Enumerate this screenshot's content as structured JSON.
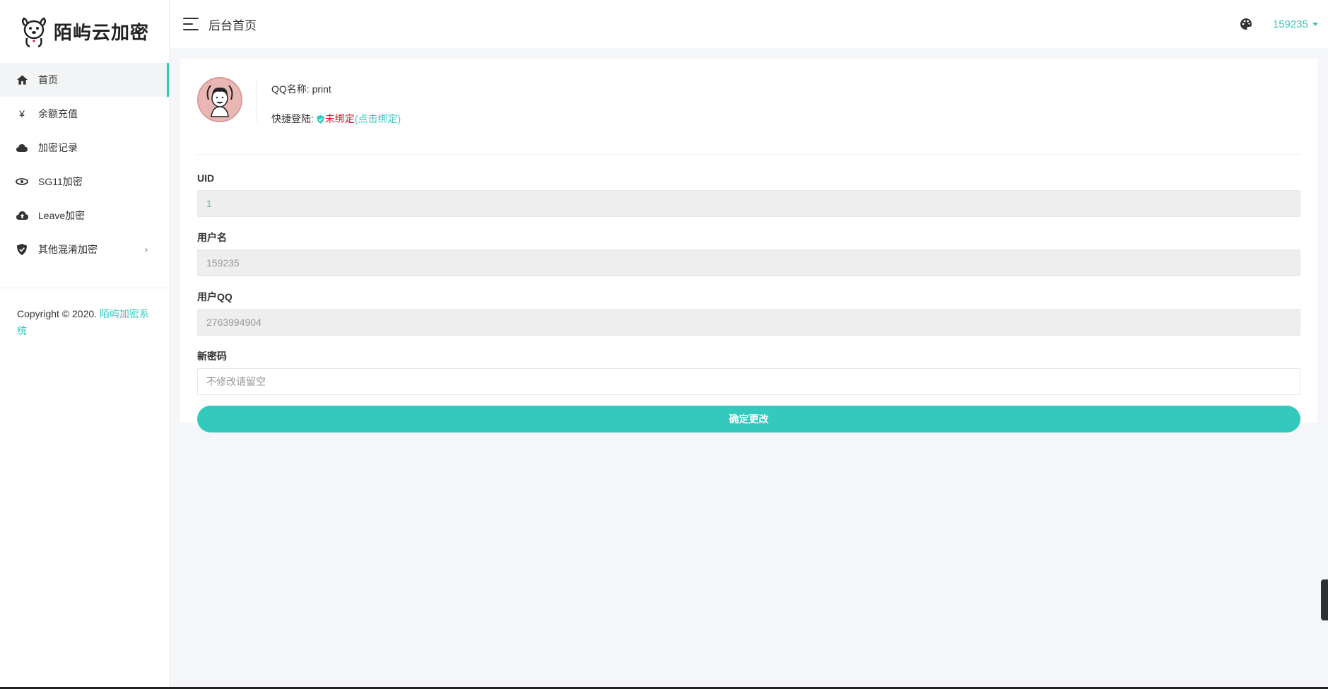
{
  "brand": {
    "name": "陌屿云加密",
    "accent": "#33c9bc"
  },
  "sidebar": {
    "items": [
      {
        "label": "首页",
        "icon": "home-icon",
        "active": true
      },
      {
        "label": "余额充值",
        "icon": "yen-icon"
      },
      {
        "label": "加密记录",
        "icon": "cloud-icon"
      },
      {
        "label": "SG11加密",
        "icon": "eye-icon"
      },
      {
        "label": "Leave加密",
        "icon": "cloud-upload-icon"
      },
      {
        "label": "其他混淆加密",
        "icon": "shield-check-icon",
        "has_submenu": true
      }
    ],
    "copyright_prefix": "Copyright © 2020.",
    "copyright_link": "陌屿加密系统"
  },
  "header": {
    "title": "后台首页",
    "username": "159235"
  },
  "profile": {
    "qq_name_label": "QQ名称:",
    "qq_name": "print",
    "quick_login_label": "快捷登陆:",
    "quick_login_status": "未绑定",
    "quick_login_action": "(点击绑定)"
  },
  "form": {
    "uid_label": "UID",
    "uid_value": "1",
    "username_label": "用户名",
    "username_value": "159235",
    "qq_label": "用户QQ",
    "qq_value": "2763994904",
    "password_label": "新密码",
    "password_placeholder": "不修改请留空",
    "submit_label": "确定更改"
  }
}
